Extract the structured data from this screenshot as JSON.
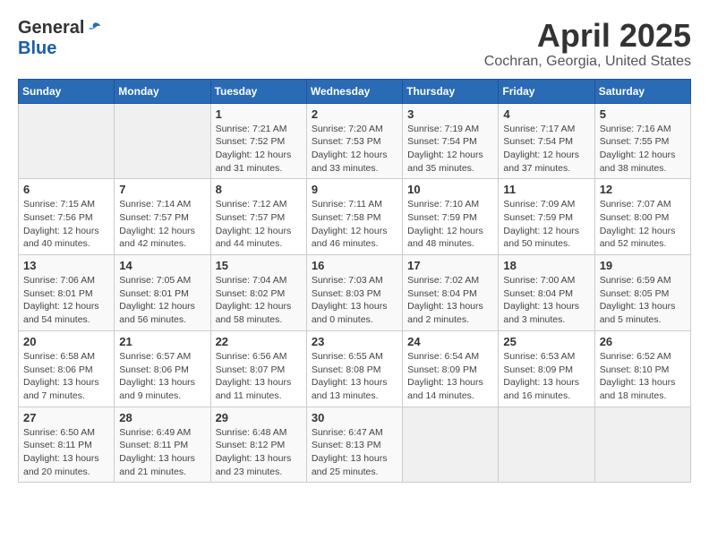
{
  "logo": {
    "general": "General",
    "blue": "Blue"
  },
  "title": "April 2025",
  "subtitle": "Cochran, Georgia, United States",
  "days_header": [
    "Sunday",
    "Monday",
    "Tuesday",
    "Wednesday",
    "Thursday",
    "Friday",
    "Saturday"
  ],
  "weeks": [
    [
      {
        "day": "",
        "sunrise": "",
        "sunset": "",
        "daylight": ""
      },
      {
        "day": "",
        "sunrise": "",
        "sunset": "",
        "daylight": ""
      },
      {
        "day": "1",
        "sunrise": "Sunrise: 7:21 AM",
        "sunset": "Sunset: 7:52 PM",
        "daylight": "Daylight: 12 hours and 31 minutes."
      },
      {
        "day": "2",
        "sunrise": "Sunrise: 7:20 AM",
        "sunset": "Sunset: 7:53 PM",
        "daylight": "Daylight: 12 hours and 33 minutes."
      },
      {
        "day": "3",
        "sunrise": "Sunrise: 7:19 AM",
        "sunset": "Sunset: 7:54 PM",
        "daylight": "Daylight: 12 hours and 35 minutes."
      },
      {
        "day": "4",
        "sunrise": "Sunrise: 7:17 AM",
        "sunset": "Sunset: 7:54 PM",
        "daylight": "Daylight: 12 hours and 37 minutes."
      },
      {
        "day": "5",
        "sunrise": "Sunrise: 7:16 AM",
        "sunset": "Sunset: 7:55 PM",
        "daylight": "Daylight: 12 hours and 38 minutes."
      }
    ],
    [
      {
        "day": "6",
        "sunrise": "Sunrise: 7:15 AM",
        "sunset": "Sunset: 7:56 PM",
        "daylight": "Daylight: 12 hours and 40 minutes."
      },
      {
        "day": "7",
        "sunrise": "Sunrise: 7:14 AM",
        "sunset": "Sunset: 7:57 PM",
        "daylight": "Daylight: 12 hours and 42 minutes."
      },
      {
        "day": "8",
        "sunrise": "Sunrise: 7:12 AM",
        "sunset": "Sunset: 7:57 PM",
        "daylight": "Daylight: 12 hours and 44 minutes."
      },
      {
        "day": "9",
        "sunrise": "Sunrise: 7:11 AM",
        "sunset": "Sunset: 7:58 PM",
        "daylight": "Daylight: 12 hours and 46 minutes."
      },
      {
        "day": "10",
        "sunrise": "Sunrise: 7:10 AM",
        "sunset": "Sunset: 7:59 PM",
        "daylight": "Daylight: 12 hours and 48 minutes."
      },
      {
        "day": "11",
        "sunrise": "Sunrise: 7:09 AM",
        "sunset": "Sunset: 7:59 PM",
        "daylight": "Daylight: 12 hours and 50 minutes."
      },
      {
        "day": "12",
        "sunrise": "Sunrise: 7:07 AM",
        "sunset": "Sunset: 8:00 PM",
        "daylight": "Daylight: 12 hours and 52 minutes."
      }
    ],
    [
      {
        "day": "13",
        "sunrise": "Sunrise: 7:06 AM",
        "sunset": "Sunset: 8:01 PM",
        "daylight": "Daylight: 12 hours and 54 minutes."
      },
      {
        "day": "14",
        "sunrise": "Sunrise: 7:05 AM",
        "sunset": "Sunset: 8:01 PM",
        "daylight": "Daylight: 12 hours and 56 minutes."
      },
      {
        "day": "15",
        "sunrise": "Sunrise: 7:04 AM",
        "sunset": "Sunset: 8:02 PM",
        "daylight": "Daylight: 12 hours and 58 minutes."
      },
      {
        "day": "16",
        "sunrise": "Sunrise: 7:03 AM",
        "sunset": "Sunset: 8:03 PM",
        "daylight": "Daylight: 13 hours and 0 minutes."
      },
      {
        "day": "17",
        "sunrise": "Sunrise: 7:02 AM",
        "sunset": "Sunset: 8:04 PM",
        "daylight": "Daylight: 13 hours and 2 minutes."
      },
      {
        "day": "18",
        "sunrise": "Sunrise: 7:00 AM",
        "sunset": "Sunset: 8:04 PM",
        "daylight": "Daylight: 13 hours and 3 minutes."
      },
      {
        "day": "19",
        "sunrise": "Sunrise: 6:59 AM",
        "sunset": "Sunset: 8:05 PM",
        "daylight": "Daylight: 13 hours and 5 minutes."
      }
    ],
    [
      {
        "day": "20",
        "sunrise": "Sunrise: 6:58 AM",
        "sunset": "Sunset: 8:06 PM",
        "daylight": "Daylight: 13 hours and 7 minutes."
      },
      {
        "day": "21",
        "sunrise": "Sunrise: 6:57 AM",
        "sunset": "Sunset: 8:06 PM",
        "daylight": "Daylight: 13 hours and 9 minutes."
      },
      {
        "day": "22",
        "sunrise": "Sunrise: 6:56 AM",
        "sunset": "Sunset: 8:07 PM",
        "daylight": "Daylight: 13 hours and 11 minutes."
      },
      {
        "day": "23",
        "sunrise": "Sunrise: 6:55 AM",
        "sunset": "Sunset: 8:08 PM",
        "daylight": "Daylight: 13 hours and 13 minutes."
      },
      {
        "day": "24",
        "sunrise": "Sunrise: 6:54 AM",
        "sunset": "Sunset: 8:09 PM",
        "daylight": "Daylight: 13 hours and 14 minutes."
      },
      {
        "day": "25",
        "sunrise": "Sunrise: 6:53 AM",
        "sunset": "Sunset: 8:09 PM",
        "daylight": "Daylight: 13 hours and 16 minutes."
      },
      {
        "day": "26",
        "sunrise": "Sunrise: 6:52 AM",
        "sunset": "Sunset: 8:10 PM",
        "daylight": "Daylight: 13 hours and 18 minutes."
      }
    ],
    [
      {
        "day": "27",
        "sunrise": "Sunrise: 6:50 AM",
        "sunset": "Sunset: 8:11 PM",
        "daylight": "Daylight: 13 hours and 20 minutes."
      },
      {
        "day": "28",
        "sunrise": "Sunrise: 6:49 AM",
        "sunset": "Sunset: 8:11 PM",
        "daylight": "Daylight: 13 hours and 21 minutes."
      },
      {
        "day": "29",
        "sunrise": "Sunrise: 6:48 AM",
        "sunset": "Sunset: 8:12 PM",
        "daylight": "Daylight: 13 hours and 23 minutes."
      },
      {
        "day": "30",
        "sunrise": "Sunrise: 6:47 AM",
        "sunset": "Sunset: 8:13 PM",
        "daylight": "Daylight: 13 hours and 25 minutes."
      },
      {
        "day": "",
        "sunrise": "",
        "sunset": "",
        "daylight": ""
      },
      {
        "day": "",
        "sunrise": "",
        "sunset": "",
        "daylight": ""
      },
      {
        "day": "",
        "sunrise": "",
        "sunset": "",
        "daylight": ""
      }
    ]
  ]
}
